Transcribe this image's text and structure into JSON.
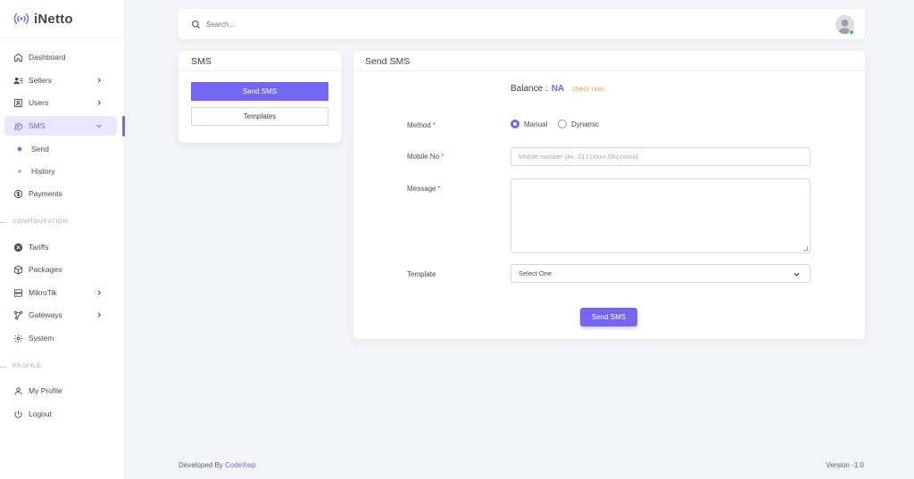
{
  "app": {
    "brand": "iNetto"
  },
  "sidebar": {
    "items": [
      {
        "label": "Dashboard"
      },
      {
        "label": "Sellers"
      },
      {
        "label": "Users"
      },
      {
        "label": "SMS"
      },
      {
        "label": "Payments"
      },
      {
        "label": "Tariffs"
      },
      {
        "label": "Packages"
      },
      {
        "label": "MikroTik"
      },
      {
        "label": "Gateways"
      },
      {
        "label": "System"
      },
      {
        "label": "My Profile"
      },
      {
        "label": "Logout"
      }
    ],
    "sms_sub": [
      {
        "label": "Send"
      },
      {
        "label": "History"
      }
    ],
    "sections": {
      "configuration": "CONFIGURATION",
      "profile": "PROFILE"
    }
  },
  "topbar": {
    "search_placeholder": "Search..."
  },
  "sms_card": {
    "title": "SMS",
    "buttons": {
      "send": "Send SMS",
      "templates": "Templates"
    }
  },
  "send_card": {
    "title": "Send SMS",
    "balance_label": "Balance :",
    "balance_value": "NA",
    "check_now": "check now",
    "method_label": "Method",
    "method_options": [
      {
        "label": "Manual",
        "checked": true
      },
      {
        "label": "Dynamic",
        "checked": false
      }
    ],
    "mobile_label": "Mobile No",
    "mobile_placeholder": "Mobile number (ex. 0171xxxx,081xxxxx)",
    "message_label": "Message",
    "template_label": "Template",
    "template_selected": "Select One",
    "required_mark": "*",
    "submit": "Send SMS"
  },
  "footer": {
    "developed_by": "Developed By",
    "developer": "CodeXwp",
    "version": "Version -1.0"
  },
  "colors": {
    "accent": "#7367f0",
    "warning": "#ff9f43",
    "danger": "#ea5455",
    "success": "#28c76f"
  }
}
